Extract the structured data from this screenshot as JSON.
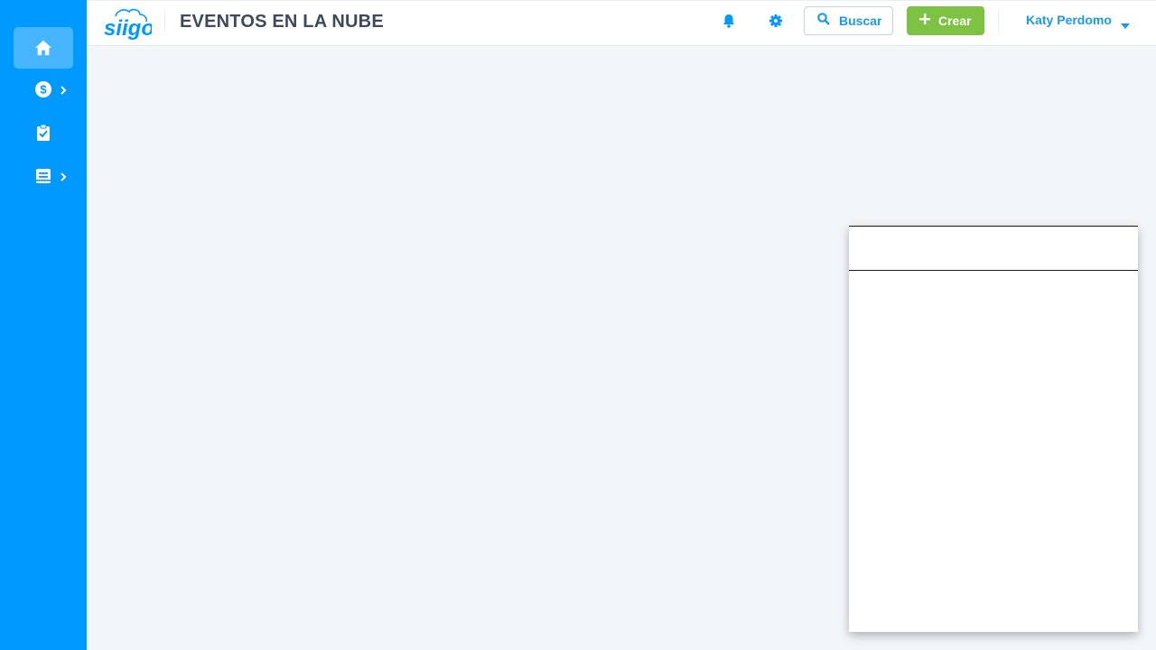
{
  "header": {
    "logo_text": "Siigo",
    "title": "EVENTOS EN LA NUBE",
    "notifications_icon": "bell-icon",
    "settings_icon": "gear-icon",
    "search_label": "Buscar",
    "create_label": "Crear",
    "user_name": "Katy Perdomo"
  },
  "sidebar": {
    "items": [
      {
        "icon": "home-icon",
        "active": true
      },
      {
        "icon": "dollar-circle-icon",
        "has_submenu": true
      },
      {
        "icon": "clipboard-check-icon"
      },
      {
        "icon": "book-icon",
        "has_submenu": true
      }
    ]
  },
  "colors": {
    "sidebar": "#0099ff",
    "accent": "#1a9ae8",
    "create_button": "#7dc242",
    "background": "#f2f6f9",
    "title": "#3d4a5c"
  }
}
